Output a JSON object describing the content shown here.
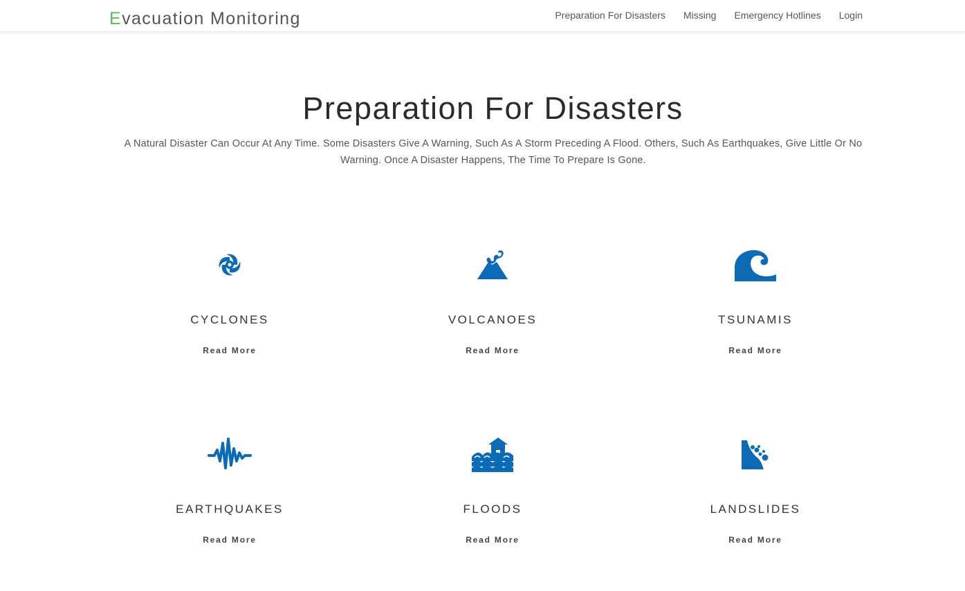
{
  "navbar": {
    "brand_first": "E",
    "brand_rest": "vacuation Monitoring",
    "links": [
      "Preparation For Disasters",
      "Missing",
      "Emergency Hotlines",
      "Login"
    ]
  },
  "hero": {
    "title": "Preparation For Disasters",
    "description": "A Natural Disaster Can Occur At Any Time. Some Disasters Give A Warning, Such As A Storm Preceding A Flood. Others, Such As Earthquakes, Give Little Or No Warning. Once A Disaster Happens, The Time To Prepare Is Gone."
  },
  "cards": [
    {
      "title": "CYCLONES",
      "icon": "cyclone-icon",
      "link": "Read More"
    },
    {
      "title": "VOLCANOES",
      "icon": "volcano-icon",
      "link": "Read More"
    },
    {
      "title": "TSUNAMIS",
      "icon": "tsunami-icon",
      "link": "Read More"
    },
    {
      "title": "EARTHQUAKES",
      "icon": "earthquake-icon",
      "link": "Read More"
    },
    {
      "title": "FLOODS",
      "icon": "flood-icon",
      "link": "Read More"
    },
    {
      "title": "LANDSLIDES",
      "icon": "landslide-icon",
      "link": "Read More"
    }
  ],
  "colors": {
    "accent_green": "#5cb85c",
    "icon_blue": "#0d6ab5"
  }
}
